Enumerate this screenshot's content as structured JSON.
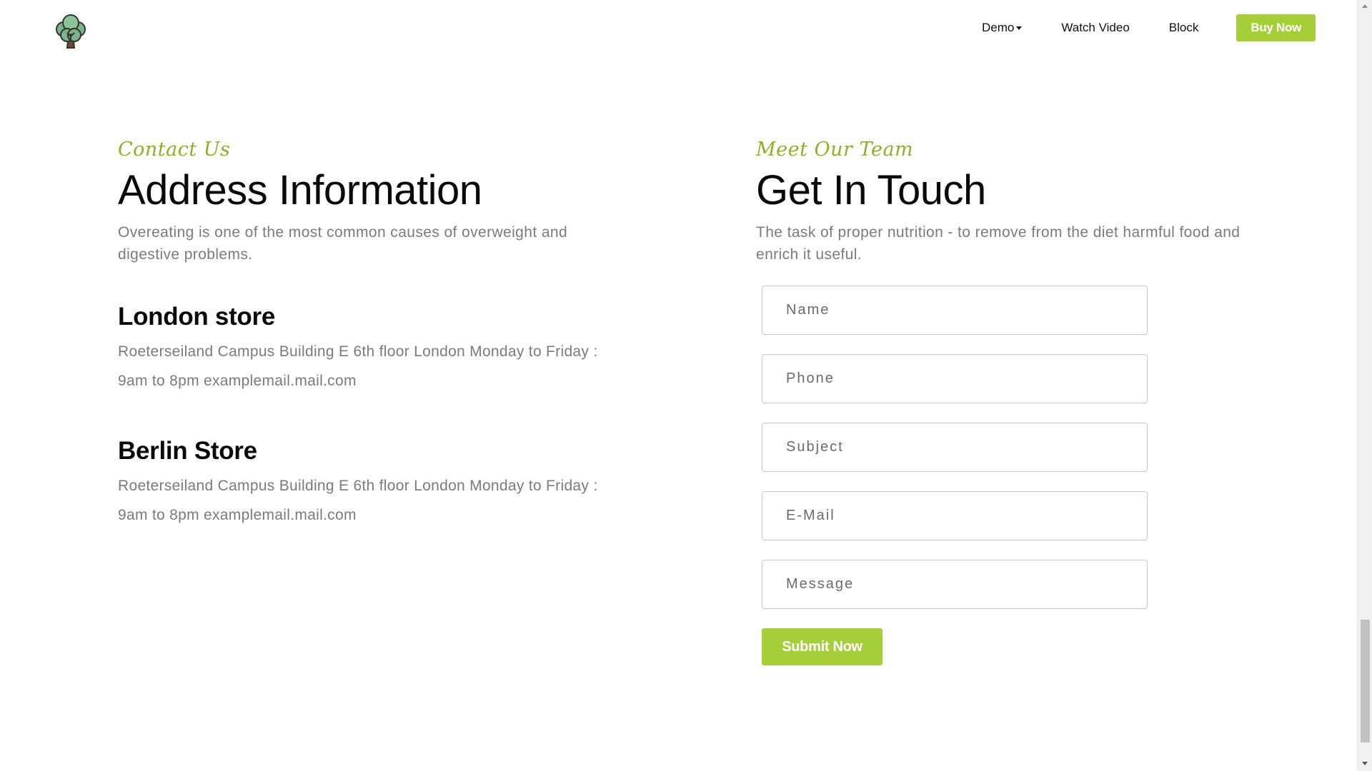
{
  "header": {
    "logo_icon": "broccoli-tree-icon",
    "nav": [
      {
        "label": "Demo",
        "has_dropdown": true
      },
      {
        "label": "Watch Video"
      },
      {
        "label": "Block"
      }
    ],
    "buy_label": "Buy Now"
  },
  "contact": {
    "script_label": "Contact Us",
    "heading": "Address Information",
    "lead": "Overeating is one of the most common causes of overweight and digestive problems.",
    "stores": [
      {
        "title": "London store",
        "text": "Roeterseiland Campus Building E 6th floor London Monday to Friday : 9am to 8pm examplemail.mail.com"
      },
      {
        "title": "Berlin Store",
        "text": "Roeterseiland Campus Building E 6th floor London Monday to Friday : 9am to 8pm examplemail.mail.com"
      }
    ]
  },
  "team": {
    "script_label": "Meet Our Team",
    "heading": "Get In Touch",
    "lead": "The task of proper nutrition - to remove from the diet harmful food and enrich it useful.",
    "fields": [
      {
        "placeholder": "Name"
      },
      {
        "placeholder": "Phone"
      },
      {
        "placeholder": "Subject"
      },
      {
        "placeholder": "E-Mail"
      },
      {
        "placeholder": "Message"
      }
    ],
    "submit_label": "Submit Now"
  },
  "colors": {
    "accent": "#a6ce39",
    "script": "#8ab226",
    "body_text": "#7a7a85"
  }
}
